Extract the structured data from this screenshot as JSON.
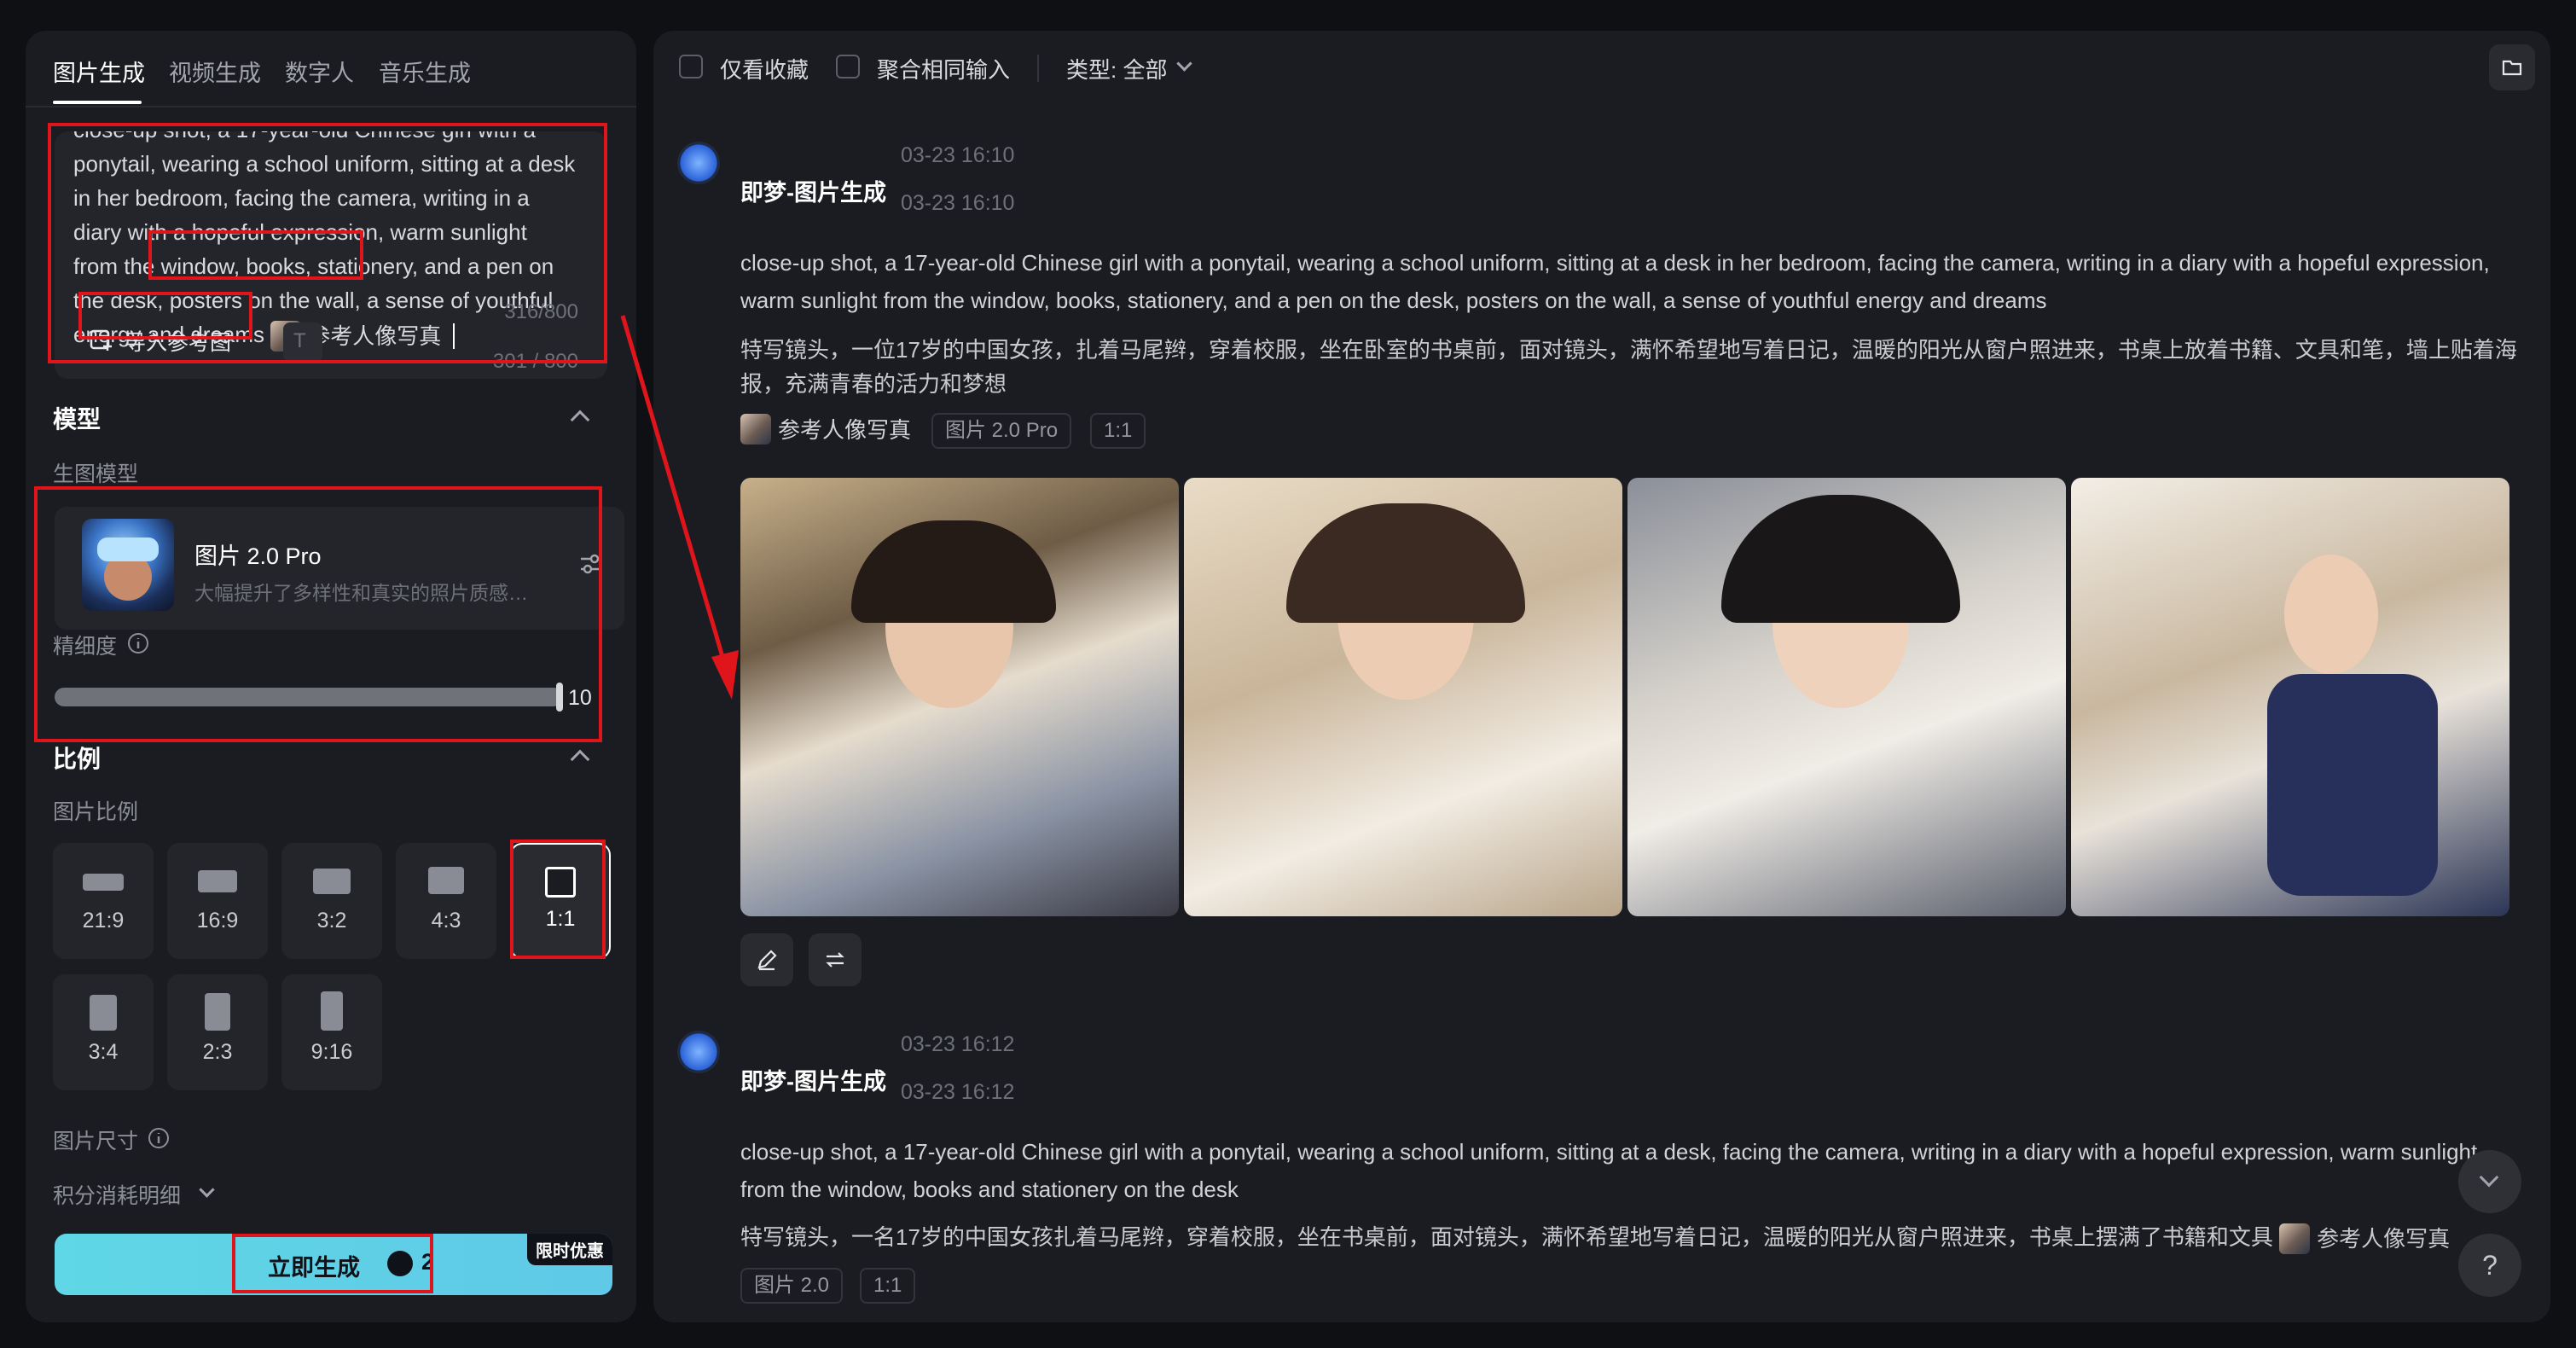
{
  "tabs": [
    {
      "label": "图片生成"
    },
    {
      "label": "视频生成"
    },
    {
      "label": "数字人"
    },
    {
      "label": "音乐生成"
    }
  ],
  "prompt": {
    "text": "close-up shot, a 17-year-old Chinese girl with a ponytail, wearing a school uniform, sitting at a desk in her bedroom, facing the camera, writing in a diary with a hopeful expression, warm sunlight from the window, books, stationery, and a pen on the desk, posters on the wall, a sense of youthful energy and dreams",
    "ref_chip": "参考人像写真",
    "count_a": "316/800",
    "count_b": "301 / 800",
    "import_label": "导入参考图"
  },
  "model_section": {
    "title": "模型",
    "sub": "生图模型",
    "name": "图片 2.0 Pro",
    "desc": "大幅提升了多样性和真实的照片质感…",
    "precision_label": "精细度",
    "precision_value": "10",
    "precision_fraction": 1.0
  },
  "ratio_section": {
    "title": "比例",
    "sub": "图片比例",
    "options": [
      {
        "label": "21:9"
      },
      {
        "label": "16:9"
      },
      {
        "label": "3:2"
      },
      {
        "label": "4:3"
      },
      {
        "label": "1:1"
      },
      {
        "label": "3:4"
      },
      {
        "label": "2:3"
      },
      {
        "label": "9:16"
      }
    ],
    "selected": "1:1",
    "size_label": "图片尺寸",
    "cost_label": "积分消耗明细"
  },
  "generate": {
    "label": "立即生成",
    "cost": "2",
    "promo": "限时优惠"
  },
  "toolbar": {
    "fav_label": "仅看收藏",
    "merge_label": "聚合相同输入",
    "type_label": "类型: 全部"
  },
  "messages": [
    {
      "name": "即梦-图片生成",
      "time1": "03-23  16:10",
      "time2": "03-23  16:10",
      "en": "close-up shot, a 17-year-old Chinese girl with a ponytail, wearing a school uniform, sitting at a desk in her bedroom, facing the camera, writing in a diary with a hopeful expression, warm sunlight from the window, books, stationery, and a pen on the desk, posters on the wall, a sense of youthful energy and dreams",
      "zh": "特写镜头，一位17岁的中国女孩，扎着马尾辫，穿着校服，坐在卧室的书桌前，面对镜头，满怀希望地写着日记，温暖的阳光从窗户照进来，书桌上放着书籍、文具和笔，墙上贴着海报，充满青春的活力和梦想",
      "tags": [
        "参考人像写真",
        "图片 2.0 Pro",
        "1:1"
      ]
    },
    {
      "name": "即梦-图片生成",
      "time1": "03-23  16:12",
      "time2": "03-23  16:12",
      "en": "close-up shot, a 17-year-old Chinese girl with a ponytail, wearing a school uniform, sitting at a desk, facing the camera, writing in a diary with a hopeful expression, warm sunlight from the window, books and stationery on the desk",
      "zh": "特写镜头，一名17岁的中国女孩扎着马尾辫，穿着校服，坐在书桌前，面对镜头，满怀希望地写着日记，温暖的阳光从窗户照进来，书桌上摆满了书籍和文具",
      "ref_chip": "参考人像写真",
      "tags": [
        "图片 2.0",
        "1:1"
      ]
    }
  ],
  "help_glyph": "?"
}
